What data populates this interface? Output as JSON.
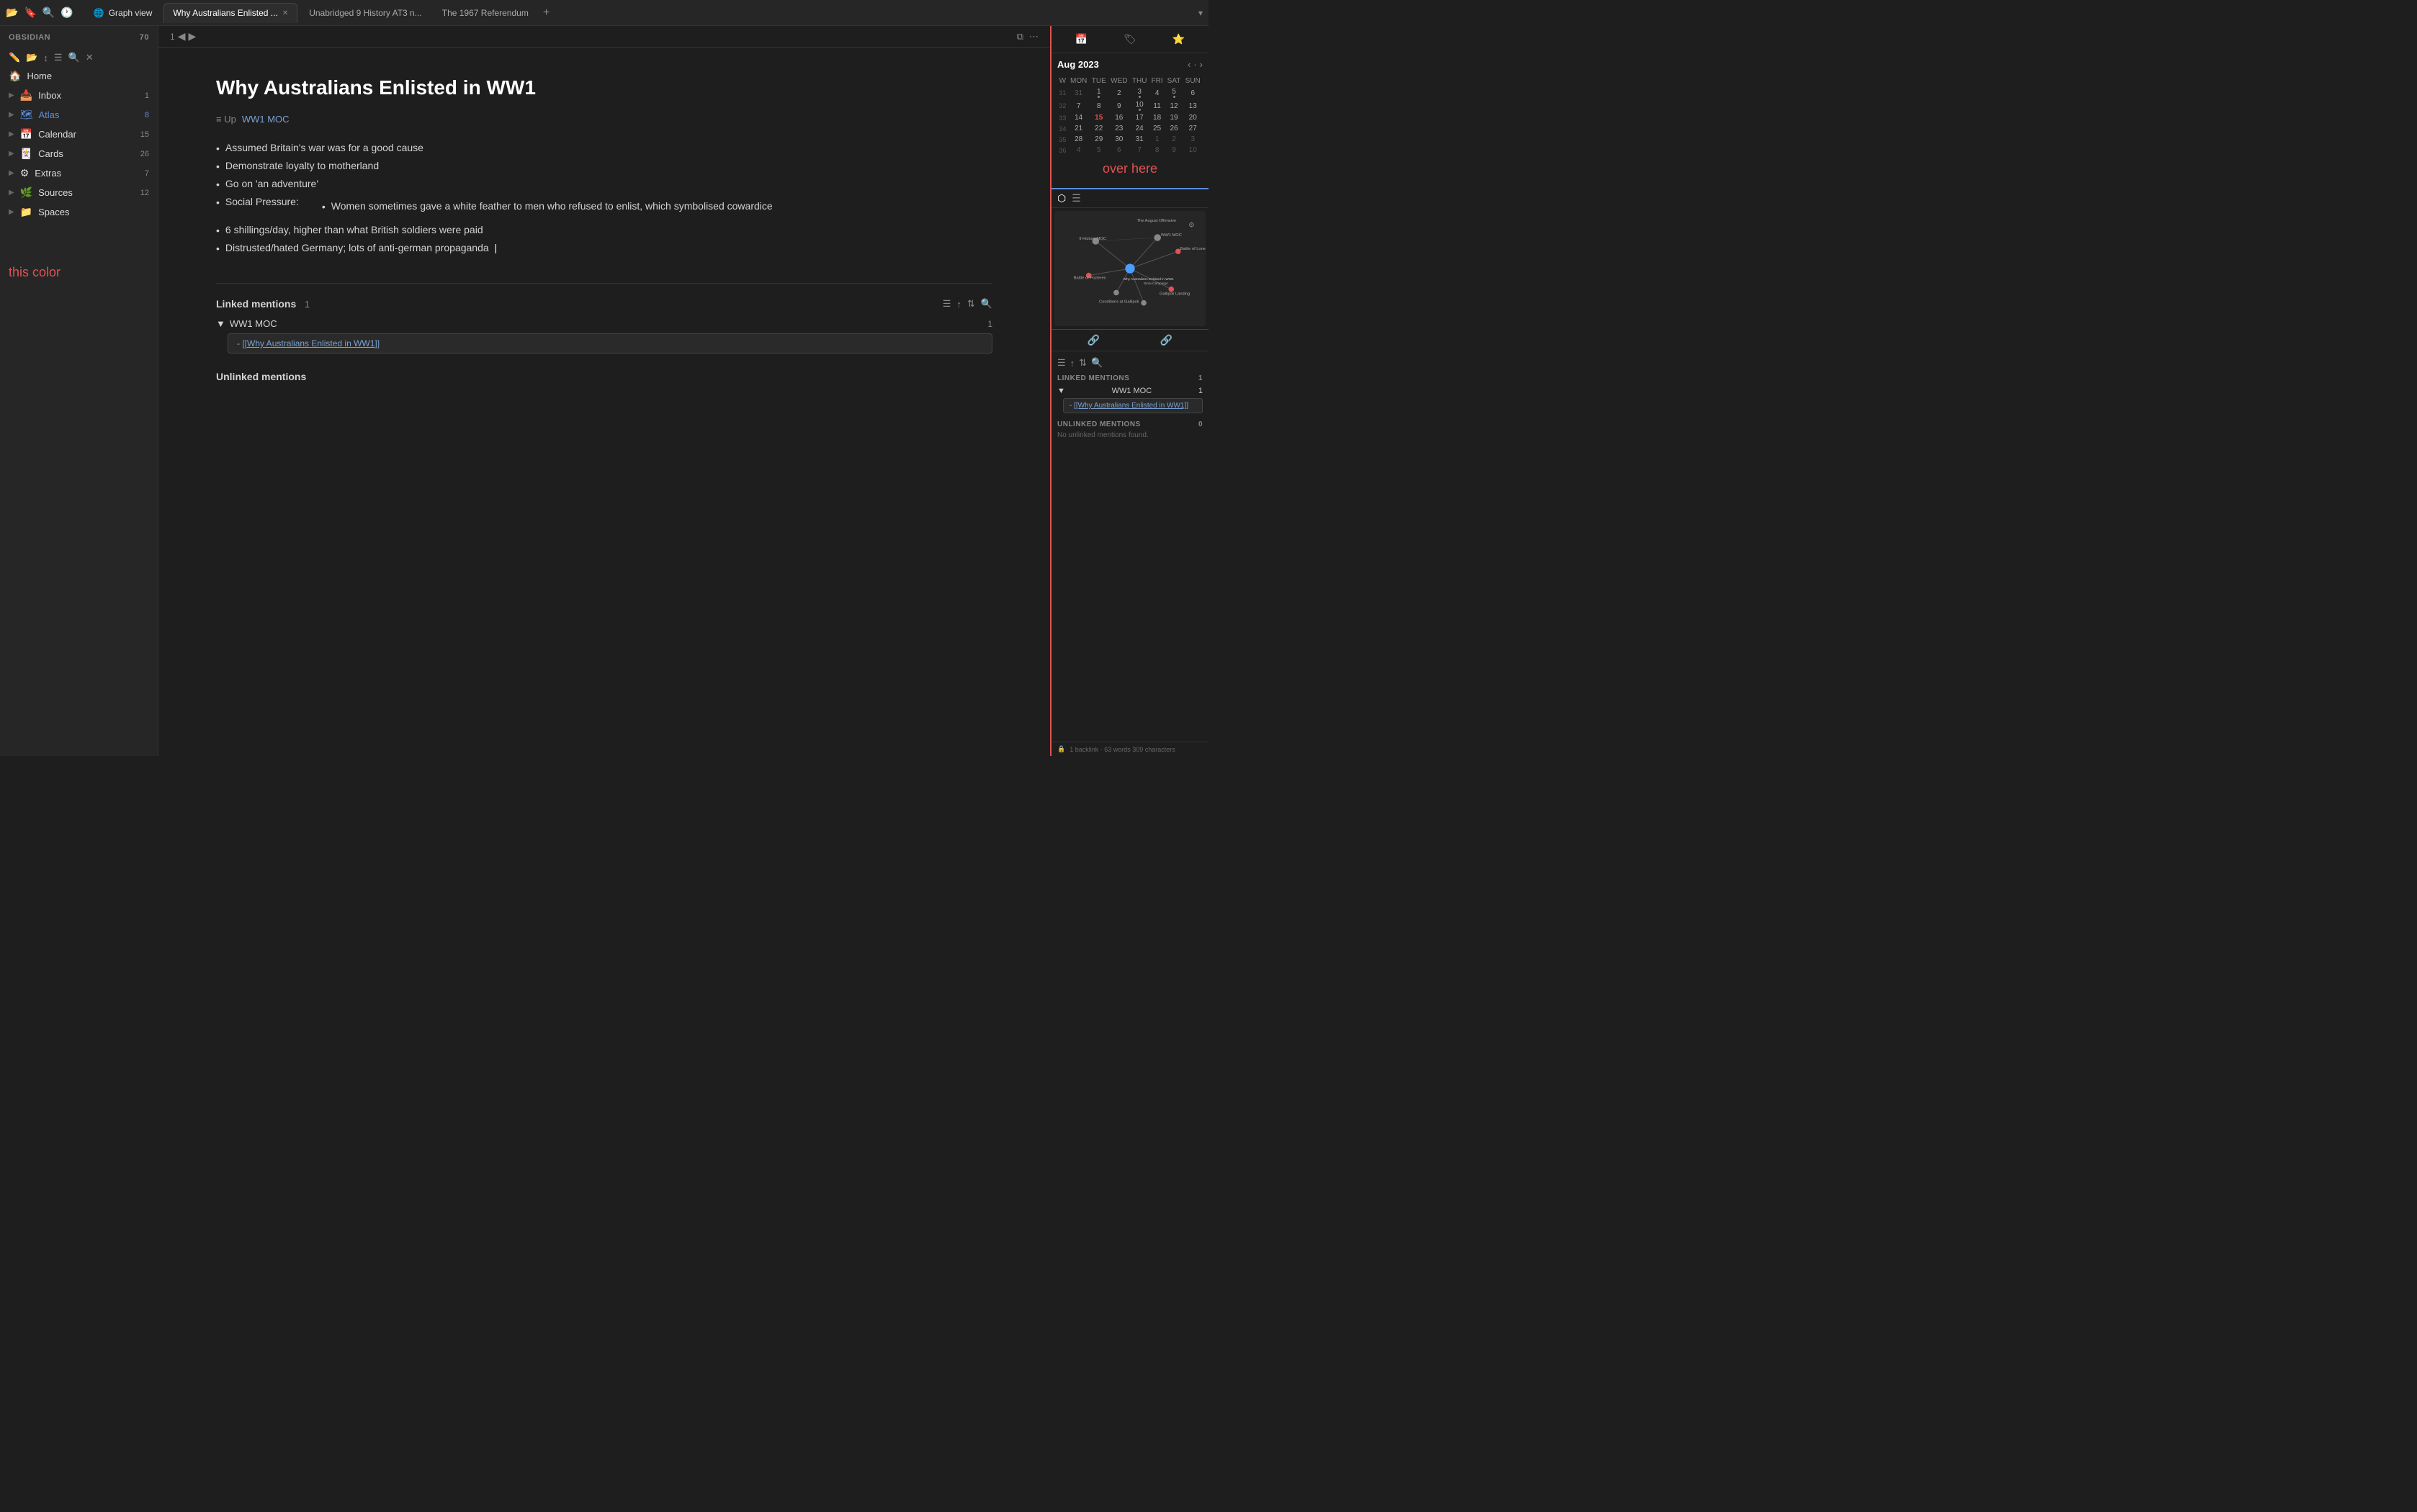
{
  "app": {
    "title": "Obsidian",
    "vault_name": "OBSIDIAN",
    "vault_count": "70"
  },
  "tab_bar": {
    "tabs": [
      {
        "id": "graph",
        "label": "Graph view",
        "active": false,
        "closeable": false
      },
      {
        "id": "main",
        "label": "Why Australians Enlisted ...",
        "active": true,
        "closeable": true
      },
      {
        "id": "unabridged",
        "label": "Unabridged 9 History AT3 n...",
        "active": false,
        "closeable": false
      },
      {
        "id": "referendum",
        "label": "The 1967 Referendum",
        "active": false,
        "closeable": false
      }
    ],
    "add_tab": "+",
    "dropdown": "▾"
  },
  "sidebar": {
    "home_label": "Home",
    "items": [
      {
        "id": "inbox",
        "icon": "📥",
        "label": "Inbox",
        "count": "1"
      },
      {
        "id": "atlas",
        "icon": "🗺",
        "label": "Atlas",
        "count": "8",
        "color_accent": "#5b8dd9"
      },
      {
        "id": "calendar",
        "icon": "📅",
        "label": "Calendar",
        "count": "15"
      },
      {
        "id": "cards",
        "icon": "🃏",
        "label": "Cards",
        "count": "26"
      },
      {
        "id": "extras",
        "icon": "⚙",
        "label": "Extras",
        "count": "7"
      },
      {
        "id": "sources",
        "icon": "🌿",
        "label": "Sources",
        "count": "12"
      },
      {
        "id": "spaces",
        "icon": "📁",
        "label": "Spaces",
        "count": ""
      }
    ],
    "this_color_label": "this color"
  },
  "editor": {
    "page_num": "1",
    "title": "Why Australians Enlisted in WW1",
    "up_label": "≡  Up",
    "up_link": "WW1 MOC",
    "bullets": [
      {
        "text": "Assumed Britain's war was for a good cause",
        "sub": []
      },
      {
        "text": "Demonstrate loyalty to motherland",
        "sub": []
      },
      {
        "text": "Go on 'an adventure'",
        "sub": []
      },
      {
        "text": "Social Pressure:",
        "sub": [
          "Women sometimes gave a white feather to men who refused to enlist, which symbolised cowardice"
        ]
      },
      {
        "text": "6 shillings/day, higher than what British soldiers were paid",
        "sub": []
      },
      {
        "text": "Distrusted/hated Germany; lots of anti-german propaganda",
        "sub": []
      }
    ],
    "linked_mentions": {
      "title": "Linked mentions",
      "count": "1",
      "groups": [
        {
          "label": "WW1 MOC",
          "count": "1",
          "items": [
            "[[Why Australians Enlisted in WW1]]"
          ]
        }
      ]
    },
    "unlinked_mentions": {
      "title": "Unlinked mentions"
    }
  },
  "right_panel": {
    "calendar": {
      "month": "Aug 2023",
      "days_of_week": [
        "W",
        "MON",
        "TUE",
        "WED",
        "THU",
        "FRI",
        "SAT",
        "SUN"
      ],
      "weeks": [
        {
          "week_num": "31",
          "days": [
            "31",
            "31",
            "1",
            "2",
            "3",
            "4",
            "5",
            "6"
          ],
          "dots": [
            false,
            false,
            false,
            true,
            false,
            true,
            false,
            true
          ]
        },
        {
          "week_num": "32",
          "days": [
            "32",
            "7",
            "8",
            "9",
            "10",
            "11",
            "12",
            "13"
          ],
          "dots": [
            false,
            false,
            false,
            false,
            true,
            false,
            false,
            false
          ]
        },
        {
          "week_num": "33",
          "days": [
            "33",
            "14",
            "15",
            "16",
            "17",
            "18",
            "19",
            "20"
          ],
          "dots": [
            false,
            false,
            false,
            false,
            false,
            false,
            false,
            false
          ],
          "today_idx": 2
        },
        {
          "week_num": "34",
          "days": [
            "34",
            "21",
            "22",
            "23",
            "24",
            "25",
            "26",
            "27"
          ],
          "dots": [
            false,
            false,
            false,
            false,
            false,
            false,
            false,
            false
          ]
        },
        {
          "week_num": "35",
          "days": [
            "35",
            "28",
            "29",
            "30",
            "31",
            "1",
            "2",
            "3"
          ],
          "dots": [
            false,
            false,
            false,
            false,
            false,
            false,
            false,
            false
          ]
        },
        {
          "week_num": "36",
          "days": [
            "36",
            "4",
            "5",
            "6",
            "7",
            "8",
            "9",
            "10"
          ],
          "dots": [
            false,
            false,
            false,
            false,
            false,
            false,
            false,
            false
          ]
        }
      ],
      "over_here_label": "over here"
    },
    "backlinks": {
      "linked_mentions_label": "LINKED MENTIONS",
      "linked_count": "1",
      "unlinked_mentions_label": "UNLINKED MENTIONS",
      "unlinked_count": "0",
      "groups": [
        {
          "label": "WW1 MOC",
          "count": "1",
          "items": [
            "[[Why Australians Enlisted in WW1]]"
          ]
        }
      ],
      "no_unlinked": "No unlinked mentions found."
    }
  },
  "status_bar": {
    "backlink_info": "1 backlink · 63 words 309 characters"
  }
}
